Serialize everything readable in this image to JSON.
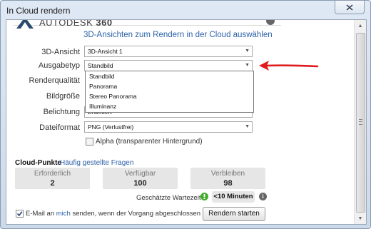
{
  "window": {
    "title": "In Cloud rendern"
  },
  "header": {
    "brand_prefix": "AUTODESK",
    "brand_suffix": "360",
    "subtitle": "3D-Ansichten zum Rendern in der Cloud auswählen"
  },
  "form": {
    "view_label": "3D-Ansicht",
    "view_value": "3D-Ansicht 1",
    "output_label": "Ausgabetyp",
    "output_value": "Standbild",
    "output_options": [
      "Standbild",
      "Panorama",
      "Stereo Panorama",
      "Illuminanz"
    ],
    "quality_label": "Renderqualität",
    "size_label": "Bildgröße",
    "exposure_label": "Belichtung",
    "exposure_value": "Erweitert",
    "format_label": "Dateiformat",
    "format_value": "PNG (Verlustfrei)",
    "alpha_label": "Alpha (transparenter Hintergrund)",
    "alpha_checked": false
  },
  "cloud": {
    "title": "Cloud-Punkte",
    "faq_link": "Häufig gestellte Fragen",
    "stats": [
      {
        "label": "Erforderlich",
        "value": "2"
      },
      {
        "label": "Verfügbar",
        "value": "100"
      },
      {
        "label": "Verbleiben",
        "value": "98"
      }
    ],
    "wait_label": "Geschätzte Wartezeit",
    "wait_value": "<10 Minuten"
  },
  "footer": {
    "email_before": "E-Mail an ",
    "email_link": "mich",
    "email_after": " senden, wenn der Vorgang abgeschlossen ist",
    "email_checked": true,
    "render_button": "Rendern starten"
  },
  "colors": {
    "accent_link": "#2d62a8",
    "annotation_arrow": "#e01b1b",
    "wait_ok": "#3fae2a"
  }
}
